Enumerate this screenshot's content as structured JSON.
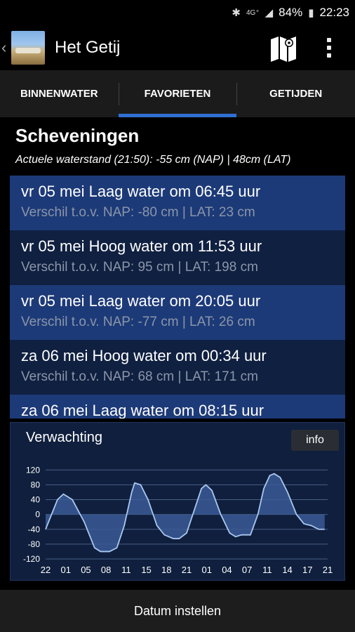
{
  "status_bar": {
    "icons": [
      "bluetooth-icon",
      "4g-icon",
      "signal-icon"
    ],
    "battery": "84%",
    "time": "22:23"
  },
  "app_bar": {
    "title": "Het Getij"
  },
  "tabs": [
    {
      "label": "BINNENWATER",
      "active": false
    },
    {
      "label": "FAVORIETEN",
      "active": true
    },
    {
      "label": "GETIJDEN",
      "active": false
    }
  ],
  "location": {
    "name": "Scheveningen",
    "current": "Actuele waterstand (21:50): -55 cm (NAP) | 48cm (LAT)"
  },
  "tides": [
    {
      "title": "vr 05 mei Laag water om 06:45 uur",
      "diff": "Verschil t.o.v. NAP: -80 cm | LAT: 23 cm"
    },
    {
      "title": "vr 05 mei Hoog water om 11:53 uur",
      "diff": "Verschil t.o.v. NAP: 95 cm | LAT: 198 cm"
    },
    {
      "title": "vr 05 mei Laag water om 20:05 uur",
      "diff": "Verschil t.o.v. NAP: -77 cm | LAT: 26 cm"
    },
    {
      "title": "za 06 mei Hoog water om 00:34 uur",
      "diff": "Verschil t.o.v. NAP: 68 cm | LAT: 171 cm"
    },
    {
      "title": "za 06 mei Laag water om 08:15 uur",
      "diff": ""
    }
  ],
  "forecast": {
    "title": "Verwachting",
    "info_label": "info",
    "colors": {
      "line": "#aac8f0",
      "fill": "#3a5a95",
      "grid": "#4b5f86",
      "text": "#ffffff"
    }
  },
  "chart_data": {
    "type": "area",
    "yticks": [
      120,
      80,
      40,
      0,
      -40,
      -80,
      -120
    ],
    "ylim": [
      -120,
      130
    ],
    "xticks": [
      "22",
      "01",
      "05",
      "08",
      "11",
      "15",
      "18",
      "21",
      "01",
      "04",
      "07",
      "11",
      "14",
      "17",
      "21"
    ],
    "points": [
      [
        0,
        -40
      ],
      [
        0.8,
        40
      ],
      [
        1.2,
        55
      ],
      [
        1.8,
        40
      ],
      [
        2.6,
        -20
      ],
      [
        3.3,
        -90
      ],
      [
        3.7,
        -100
      ],
      [
        4.3,
        -100
      ],
      [
        4.8,
        -90
      ],
      [
        5.3,
        -30
      ],
      [
        5.8,
        60
      ],
      [
        6.0,
        85
      ],
      [
        6.4,
        80
      ],
      [
        6.9,
        40
      ],
      [
        7.5,
        -30
      ],
      [
        8.0,
        -55
      ],
      [
        8.6,
        -65
      ],
      [
        9.0,
        -65
      ],
      [
        9.5,
        -50
      ],
      [
        10.0,
        10
      ],
      [
        10.5,
        70
      ],
      [
        10.8,
        80
      ],
      [
        11.2,
        65
      ],
      [
        11.8,
        0
      ],
      [
        12.4,
        -50
      ],
      [
        12.8,
        -60
      ],
      [
        13.2,
        -55
      ],
      [
        13.8,
        -55
      ],
      [
        14.3,
        0
      ],
      [
        14.7,
        70
      ],
      [
        15.1,
        105
      ],
      [
        15.4,
        110
      ],
      [
        15.8,
        100
      ],
      [
        16.3,
        60
      ],
      [
        16.9,
        0
      ],
      [
        17.4,
        -25
      ],
      [
        17.9,
        -30
      ],
      [
        18.4,
        -40
      ],
      [
        18.8,
        -40
      ]
    ],
    "x_span": 19,
    "grid": true
  },
  "bottom_bar": {
    "label": "Datum instellen"
  }
}
